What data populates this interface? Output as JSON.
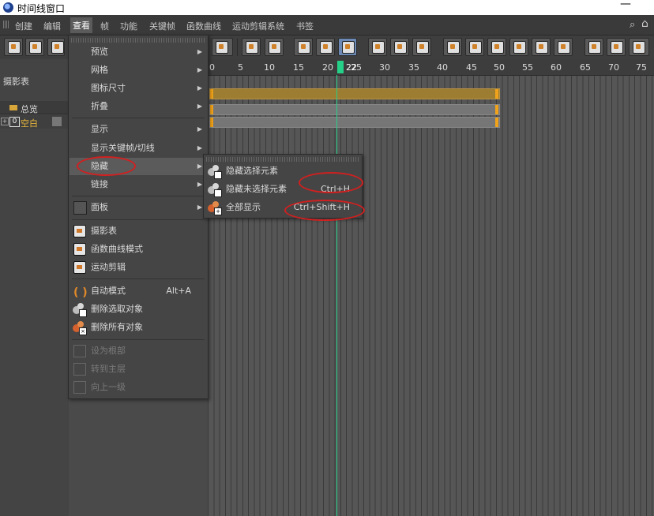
{
  "window": {
    "title": "时间线窗口",
    "minimize_label": "—"
  },
  "menubar": {
    "items": [
      "创建",
      "编辑",
      "查看",
      "帧",
      "功能",
      "关键帧",
      "函数曲线",
      "运动剪辑系统",
      "书签"
    ],
    "active": "查看"
  },
  "left_panel": {
    "label": "摄影表",
    "header": "总览",
    "row": "空白"
  },
  "ruler": {
    "ticks": [
      "0",
      "5",
      "10",
      "15",
      "20",
      "25",
      "30",
      "35",
      "40",
      "45",
      "50",
      "55",
      "60",
      "65",
      "70",
      "75"
    ],
    "current_frame": "22"
  },
  "view_menu": {
    "items": [
      {
        "label": "预览",
        "submenu": true
      },
      {
        "label": "网格",
        "submenu": true
      },
      {
        "label": "图标尺寸",
        "submenu": true
      },
      {
        "label": "折叠",
        "submenu": true
      },
      {
        "label": "显示",
        "submenu": true
      },
      {
        "label": "显示关键帧/切线",
        "submenu": true
      },
      {
        "label": "隐藏",
        "submenu": true,
        "highlighted": true
      },
      {
        "label": "链接",
        "submenu": true
      },
      {
        "label": "面板",
        "submenu": true
      },
      {
        "label": "摄影表",
        "icon": "dopesheet-icon"
      },
      {
        "label": "函数曲线模式",
        "icon": "fcurve-icon"
      },
      {
        "label": "运动剪辑",
        "icon": "motion-clip-icon"
      },
      {
        "label": "自动模式",
        "shortcut": "Alt+A",
        "icon": "auto-mode-icon"
      },
      {
        "label": "删除选取对象",
        "icon": "remove-selected-icon"
      },
      {
        "label": "删除所有对象",
        "icon": "remove-all-icon"
      },
      {
        "label": "设为根部",
        "disabled": true
      },
      {
        "label": "转到主层",
        "disabled": true
      },
      {
        "label": "向上一级",
        "disabled": true
      }
    ]
  },
  "hide_submenu": {
    "items": [
      {
        "label": "隐藏选择元素",
        "shortcut": ""
      },
      {
        "label": "隐藏未选择元素",
        "shortcut": "Ctrl+H"
      },
      {
        "label": "全部显示",
        "shortcut": "Ctrl+Shift+H"
      }
    ]
  },
  "colors": {
    "accent": "#25d089",
    "track": "#9c7d32",
    "keyframe": "#f0a21a",
    "annotation": "#d02020"
  }
}
